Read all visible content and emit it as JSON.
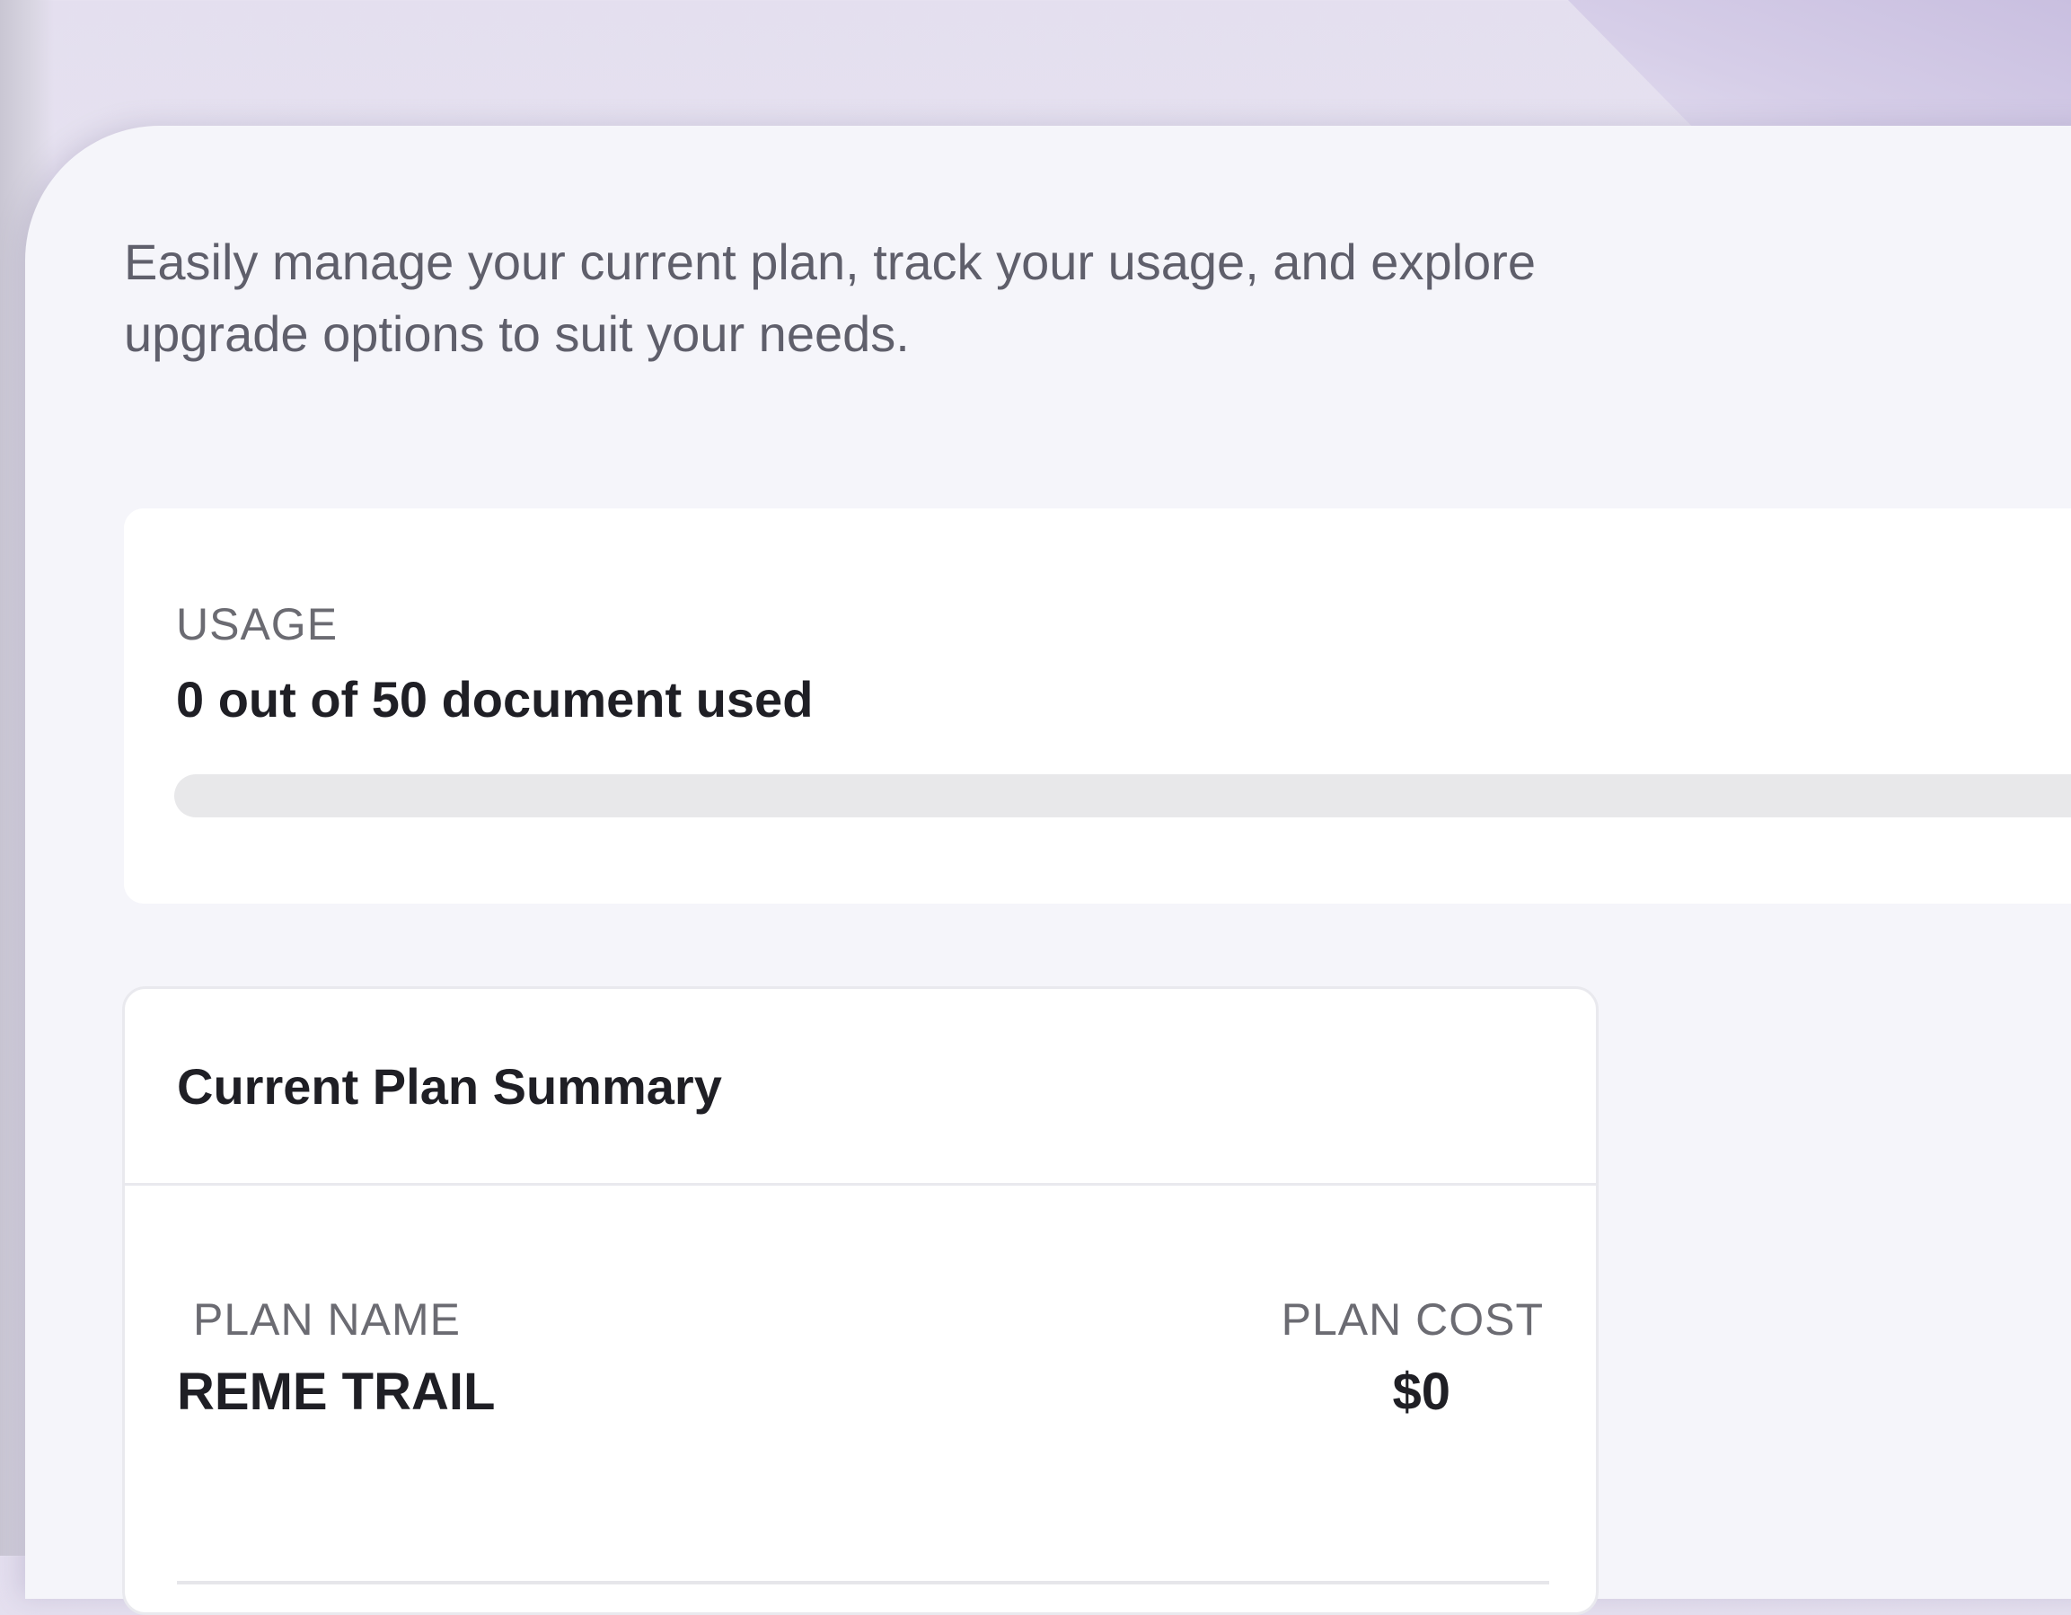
{
  "intro": {
    "text": "Easily manage your current plan, track your usage, and explore upgrade options to suit your needs."
  },
  "usage": {
    "label": "USAGE",
    "summary": "0 out of 50 document used",
    "used": 0,
    "total": 50,
    "progress_fraction": 0.0
  },
  "plan_summary": {
    "title": "Current Plan Summary",
    "plan_name_label": "PLAN NAME",
    "plan_name": "REME TRAIL",
    "plan_cost_label": "PLAN COST",
    "plan_cost": "$0"
  },
  "colors": {
    "panel_bg": "#f5f5fa",
    "card_bg": "#ffffff",
    "progress_track": "#e8e8ea",
    "accent": "#8f7fc4"
  }
}
